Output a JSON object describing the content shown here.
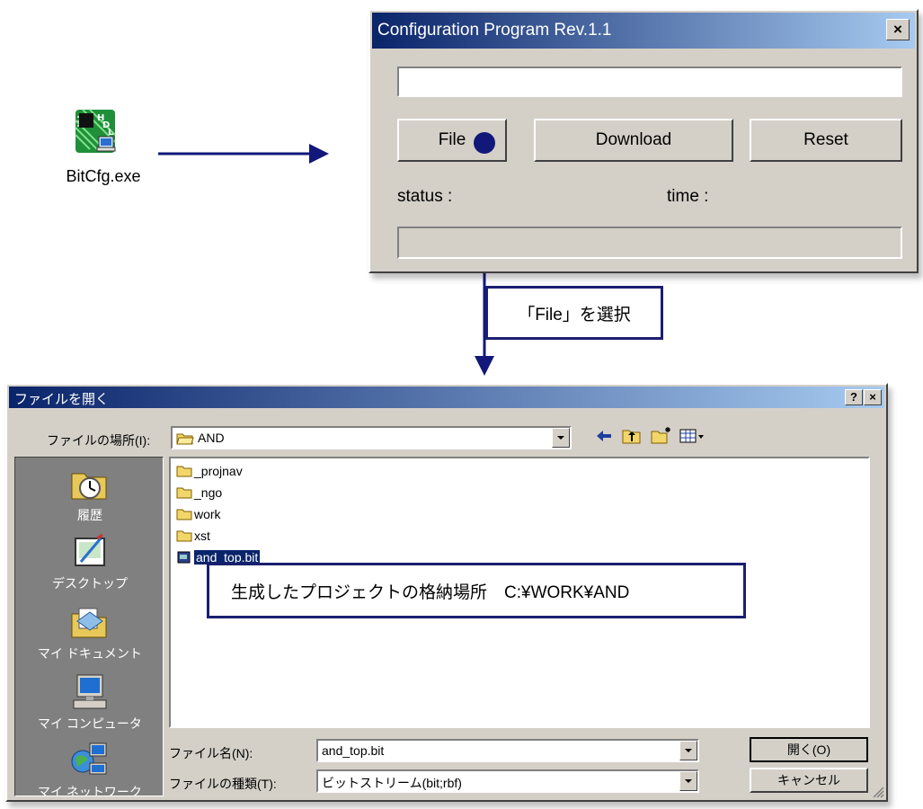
{
  "desktop_icon": {
    "label": "BitCfg.exe",
    "icon": "hdl-app-icon"
  },
  "config_window": {
    "title": "Configuration Program  Rev.1.1",
    "close_label": "×",
    "path_value": "",
    "buttons": {
      "file": "File",
      "download": "Download",
      "reset": "Reset"
    },
    "status_label": "status :",
    "time_label": "time :"
  },
  "annotations": {
    "select_file": "「File」を選択",
    "project_location": "生成したプロジェクトの格納場所　C:¥WORK¥AND"
  },
  "open_dialog": {
    "title": "ファイルを開く",
    "help_label": "?",
    "close_label": "×",
    "look_in_label": "ファイルの場所(I):",
    "look_in_value": "AND",
    "toolbar_icons": [
      "back-arrow-icon",
      "up-folder-icon",
      "new-folder-icon",
      "view-menu-icon"
    ],
    "places": [
      "履歴",
      "デスクトップ",
      "マイ ドキュメント",
      "マイ コンピュータ",
      "マイ ネットワーク"
    ],
    "files": [
      {
        "name": "_projnav",
        "type": "folder"
      },
      {
        "name": "_ngo",
        "type": "folder"
      },
      {
        "name": "work",
        "type": "folder"
      },
      {
        "name": "xst",
        "type": "folder"
      },
      {
        "name": "and_top.bit",
        "type": "file",
        "selected": true
      }
    ],
    "filename_label": "ファイル名(N):",
    "filename_value": "and_top.bit",
    "filetype_label": "ファイルの種類(T):",
    "filetype_value": "ビットストリーム(bit;rbf)",
    "open_button": "開く(O)",
    "cancel_button": "キャンセル"
  },
  "colors": {
    "arrow": "#12187a",
    "titlebar_start": "#0a246a",
    "titlebar_end": "#a6caf0",
    "face": "#d4d0c8"
  }
}
